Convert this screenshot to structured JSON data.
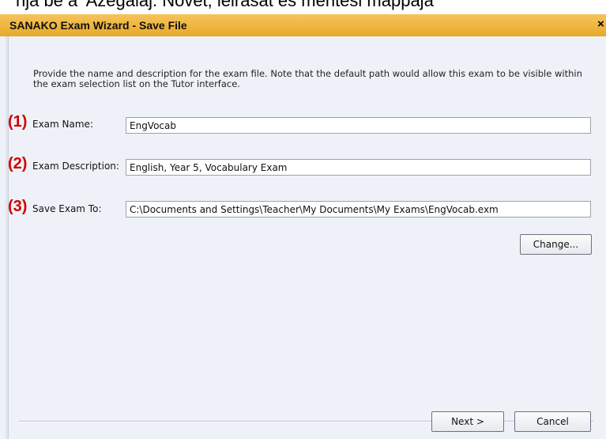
{
  "background_caption": "rija be a 'Azegalaj. Novet, leirasat es mentesi mappaja",
  "window": {
    "title": "SANAKO Exam Wizard - Save File",
    "close_glyph": "×"
  },
  "intro_text": "Provide the name and description for the exam file. Note that the default path would allow this exam to be visible within the exam selection list on the Tutor interface.",
  "fields": [
    {
      "marker": "(1)",
      "label": "Exam Name:",
      "value": "EngVocab"
    },
    {
      "marker": "(2)",
      "label": "Exam Description:",
      "value": "English, Year 5, Vocabulary Exam"
    },
    {
      "marker": "(3)",
      "label": "Save Exam To:",
      "value": "C:\\Documents and Settings\\Teacher\\My Documents\\My Exams\\EngVocab.exm"
    }
  ],
  "buttons": {
    "change": "Change...",
    "next": "Next >",
    "cancel": "Cancel"
  },
  "colors": {
    "title_bar": "#efb53f",
    "marker": "#d20000",
    "panel": "#eef2f8"
  }
}
